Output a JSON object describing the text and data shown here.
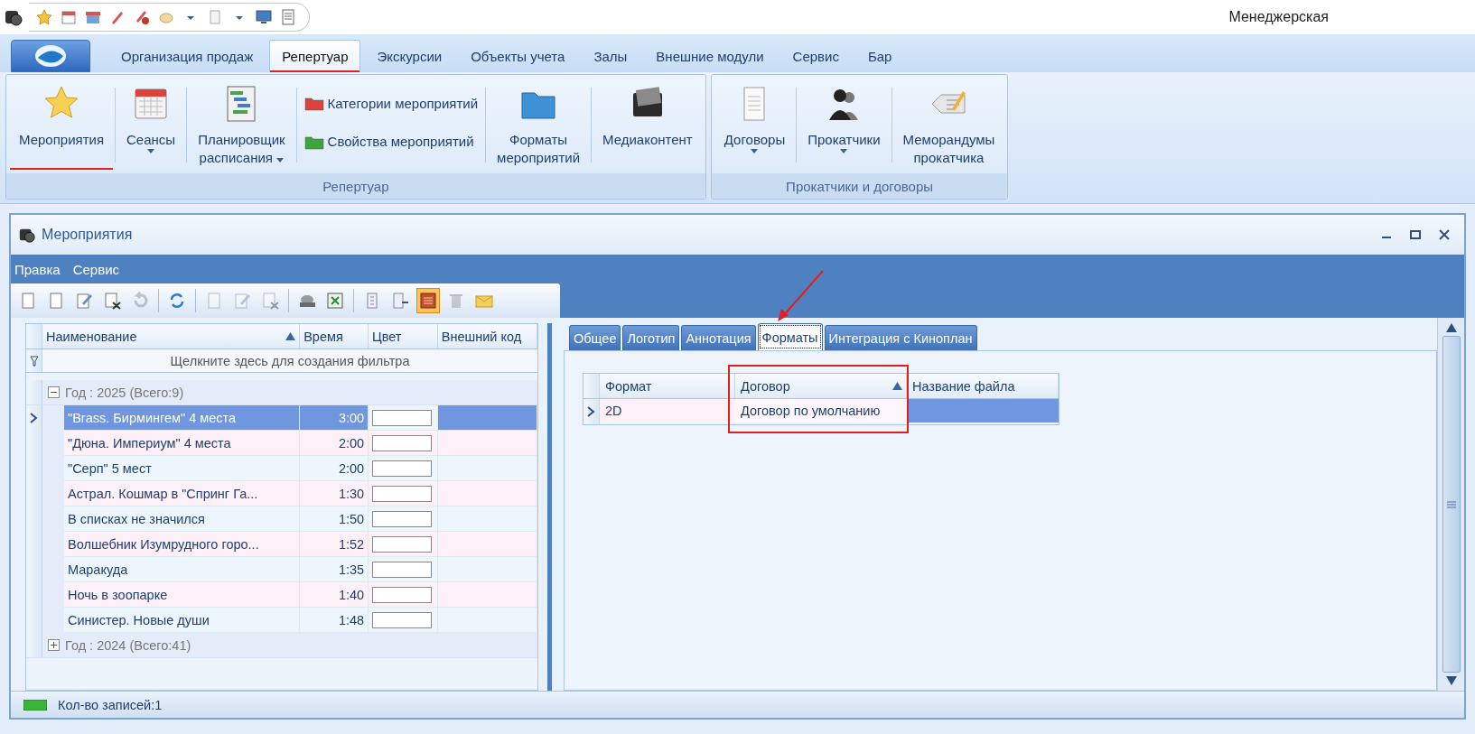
{
  "app_title": "Менеджерская",
  "main_tabs": [
    {
      "label": "Организация продаж",
      "selected": false,
      "underlined": false
    },
    {
      "label": "Репертуар",
      "selected": true,
      "underlined": true
    },
    {
      "label": "Экскурсии",
      "selected": false,
      "underlined": false
    },
    {
      "label": "Объекты учета",
      "selected": false,
      "underlined": false
    },
    {
      "label": "Залы",
      "selected": false,
      "underlined": false
    },
    {
      "label": "Внешние модули",
      "selected": false,
      "underlined": false
    },
    {
      "label": "Сервис",
      "selected": false,
      "underlined": false
    },
    {
      "label": "Бар",
      "selected": false,
      "underlined": false
    }
  ],
  "ribbon_groups": [
    {
      "caption": "Репертуар",
      "items": [
        {
          "kind": "large",
          "lines": [
            "Мероприятия"
          ],
          "dropdown": false,
          "underlined": true
        },
        {
          "kind": "large",
          "lines": [
            "Сеансы"
          ],
          "dropdown": true,
          "underlined": false
        },
        {
          "kind": "large",
          "lines": [
            "Планировщик",
            "расписания"
          ],
          "dropdown": true,
          "underlined": false
        },
        {
          "kind": "stack",
          "buttons": [
            "Категории мероприятий",
            "Свойства мероприятий"
          ]
        },
        {
          "kind": "large",
          "lines": [
            "Форматы",
            "мероприятий"
          ],
          "dropdown": false,
          "underlined": false
        },
        {
          "kind": "large",
          "lines": [
            "Медиаконтент"
          ],
          "dropdown": false,
          "underlined": false
        }
      ]
    },
    {
      "caption": "Прокатчики и договоры",
      "items": [
        {
          "kind": "large",
          "lines": [
            "Договоры"
          ],
          "dropdown": true,
          "underlined": false
        },
        {
          "kind": "large",
          "lines": [
            "Прокатчики"
          ],
          "dropdown": true,
          "underlined": false
        },
        {
          "kind": "large",
          "lines": [
            "Меморандумы",
            "прокатчика"
          ],
          "dropdown": false,
          "underlined": false
        }
      ]
    }
  ],
  "window": {
    "title": "Мероприятия",
    "menu": [
      "Правка",
      "Сервис"
    ],
    "toolbar": [
      {
        "kind": "button",
        "disabled": false,
        "on": false
      },
      {
        "kind": "button",
        "disabled": false,
        "on": false
      },
      {
        "kind": "button",
        "disabled": false,
        "on": false
      },
      {
        "kind": "button",
        "disabled": false,
        "on": false
      },
      {
        "kind": "button",
        "disabled": true,
        "on": false
      },
      {
        "kind": "separator"
      },
      {
        "kind": "button",
        "disabled": false,
        "on": false
      },
      {
        "kind": "separator"
      },
      {
        "kind": "button",
        "disabled": true,
        "on": false
      },
      {
        "kind": "button",
        "disabled": true,
        "on": false
      },
      {
        "kind": "button",
        "disabled": true,
        "on": false
      },
      {
        "kind": "separator"
      },
      {
        "kind": "button",
        "disabled": false,
        "on": false
      },
      {
        "kind": "button",
        "disabled": false,
        "on": false
      },
      {
        "kind": "separator"
      },
      {
        "kind": "button",
        "disabled": false,
        "on": false
      },
      {
        "kind": "button",
        "disabled": false,
        "on": false
      },
      {
        "kind": "button",
        "disabled": false,
        "on": true
      },
      {
        "kind": "button",
        "disabled": true,
        "on": false
      },
      {
        "kind": "button",
        "disabled": false,
        "on": false
      }
    ]
  },
  "events_grid": {
    "columns": [
      {
        "label": "Наименование",
        "sorted": true
      },
      {
        "label": "Время",
        "sorted": false
      },
      {
        "label": "Цвет",
        "sorted": false
      },
      {
        "label": "Внешний код",
        "sorted": false
      }
    ],
    "filter_hint": "Щелкните здесь для создания фильтра",
    "groups": [
      {
        "label": "Год : 2025 (Всего:9)",
        "expanded": true,
        "rows": [
          {
            "name": "\"Brass. Бирмингем\" 4 места",
            "time": "3:00",
            "color": "#ffffff",
            "selected": true
          },
          {
            "name": "\"Дюна. Империум\" 4 места",
            "time": "2:00",
            "color": "#ffffff",
            "selected": false
          },
          {
            "name": "\"Серп\" 5 мест",
            "time": "2:00",
            "color": "#ffffff",
            "selected": false
          },
          {
            "name": "Астрал. Кошмар в \"Спринг Га...",
            "time": "1:30",
            "color": "#ffffff",
            "selected": false
          },
          {
            "name": "В списках не значился",
            "time": "1:50",
            "color": "#ffffff",
            "selected": false
          },
          {
            "name": "Волшебник Изумрудного горо...",
            "time": "1:52",
            "color": "#ffffff",
            "selected": false
          },
          {
            "name": "Маракуда",
            "time": "1:35",
            "color": "#ffffff",
            "selected": false
          },
          {
            "name": "Ночь в зоопарке",
            "time": "1:40",
            "color": "#ffffff",
            "selected": false
          },
          {
            "name": "Синистер. Новые души",
            "time": "1:48",
            "color": "#ffffff",
            "selected": false
          }
        ]
      },
      {
        "label": "Год : 2024 (Всего:41)",
        "expanded": false
      }
    ]
  },
  "detail_tabs": [
    {
      "label": "Общее",
      "selected": false,
      "arrow": false
    },
    {
      "label": "Логотип",
      "selected": false,
      "arrow": false
    },
    {
      "label": "Аннотация",
      "selected": false,
      "arrow": false
    },
    {
      "label": "Форматы",
      "selected": true,
      "arrow": true
    },
    {
      "label": "Интеграция с Киноплан",
      "selected": false,
      "arrow": false
    }
  ],
  "formats_grid": {
    "columns": [
      {
        "label": "Формат",
        "sorted": false
      },
      {
        "label": "Договор",
        "sorted": true,
        "boxed": true
      },
      {
        "label": "Название файла",
        "sorted": false
      }
    ],
    "rows": [
      {
        "format": "2D",
        "contract": "Договор по умолчанию",
        "selected": true
      }
    ]
  },
  "status_bar": {
    "text": "Кол-во записей:1"
  }
}
